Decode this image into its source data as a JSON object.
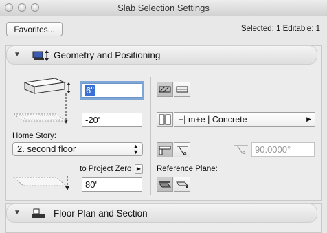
{
  "window": {
    "title": "Slab Selection Settings"
  },
  "toolbar": {
    "favorites_label": "Favorites..."
  },
  "selection": {
    "info": "Selected: 1 Editable: 1"
  },
  "geometry": {
    "header": "Geometry and Positioning",
    "thickness": "6\"",
    "offset": "-20'",
    "home_story_label": "Home Story:",
    "home_story_value": "2. second floor",
    "to_project_zero_label": "to Project Zero",
    "project_zero_value": "80'",
    "material": "−| m+e | Concrete",
    "angle": "90.0000°",
    "reference_plane_label": "Reference Plane:"
  },
  "floorplan": {
    "header": "Floor Plan and Section"
  },
  "icons": {
    "collapse": "disclosure-triangle-icon",
    "slab": "slab-icon",
    "floorplan": "floor-plan-icon"
  },
  "colors": {
    "focus_ring": "#7ea7d8",
    "selection": "#3a6fd8"
  }
}
